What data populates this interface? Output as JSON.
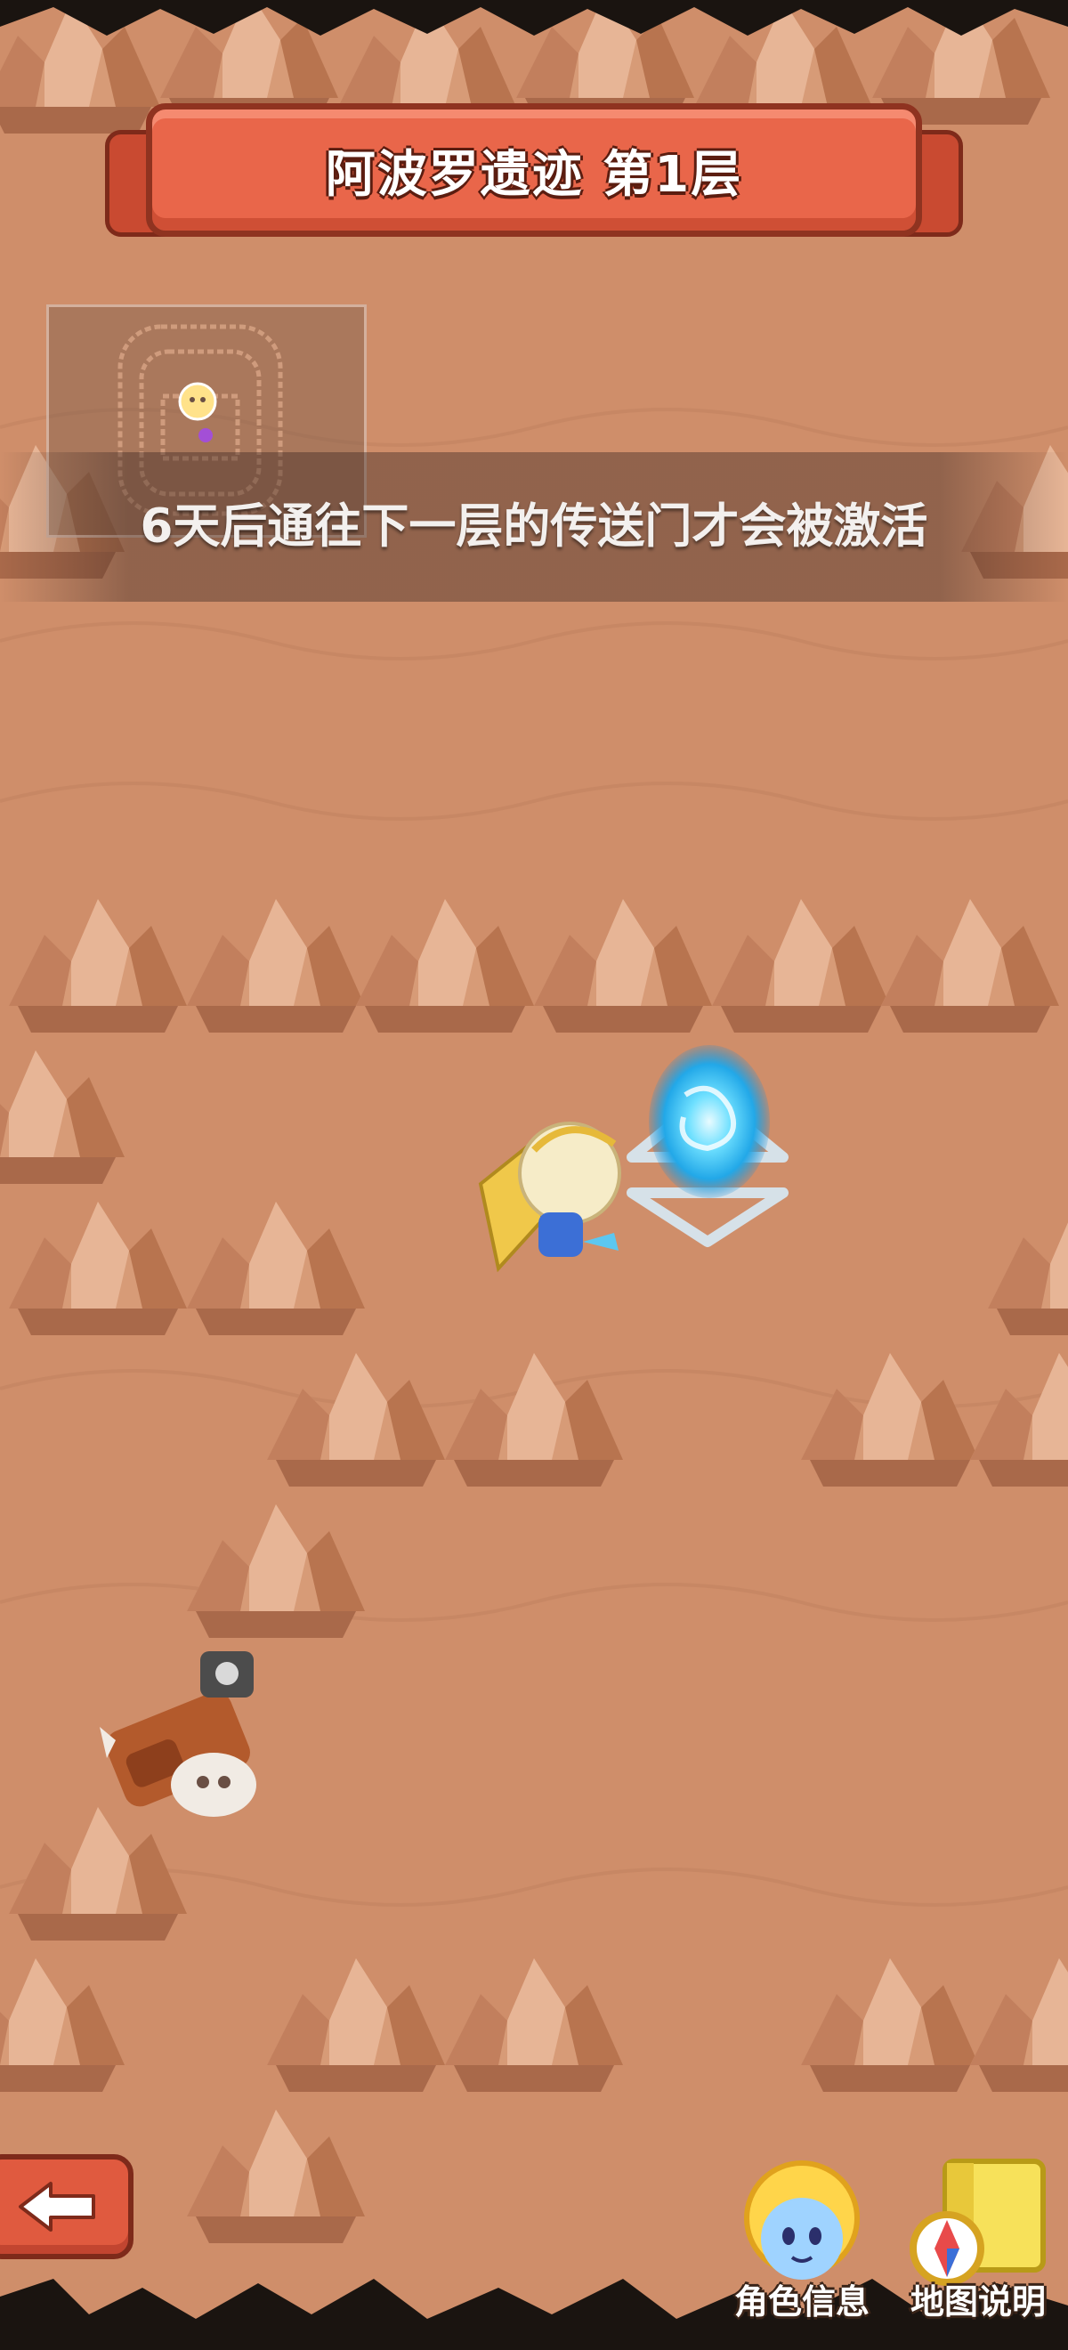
{
  "header": {
    "title": "阿波罗遗迹 第1层"
  },
  "notice": {
    "text": "6天后通往下一层的传送门才会被激活"
  },
  "buttons": {
    "back_icon": "back-arrow-icon",
    "role_info_label": "角色信息",
    "role_info_icon": "character-portrait-icon",
    "map_guide_label": "地图说明",
    "map_guide_icon": "map-compass-icon"
  },
  "colors": {
    "ground": "#cf8e6a",
    "rock": "#d9a07c",
    "ribbon": "#e9664a",
    "portal": "#35c8ff"
  }
}
